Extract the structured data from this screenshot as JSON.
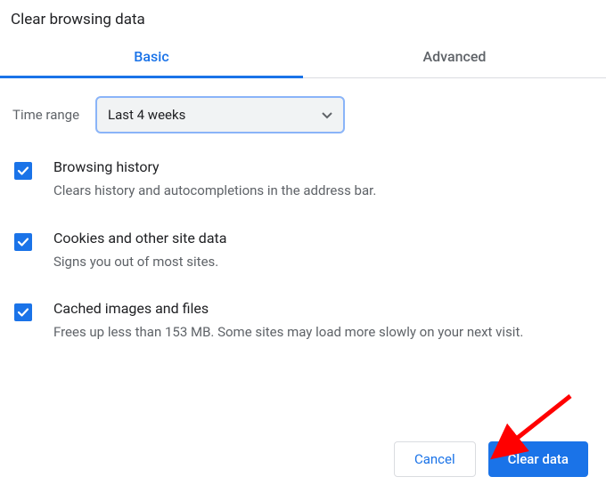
{
  "title": "Clear browsing data",
  "tabs": {
    "basic": "Basic",
    "advanced": "Advanced"
  },
  "time_range": {
    "label": "Time range",
    "value": "Last 4 weeks"
  },
  "options": [
    {
      "title": "Browsing history",
      "description": "Clears history and autocompletions in the address bar."
    },
    {
      "title": "Cookies and other site data",
      "description": "Signs you out of most sites."
    },
    {
      "title": "Cached images and files",
      "description": "Frees up less than 153 MB. Some sites may load more slowly on your next visit."
    }
  ],
  "buttons": {
    "cancel": "Cancel",
    "clear": "Clear data"
  }
}
